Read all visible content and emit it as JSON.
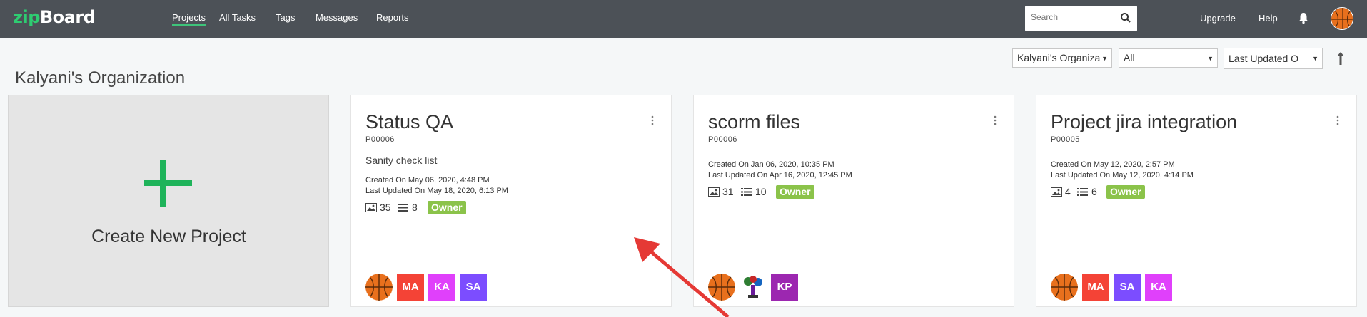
{
  "app": {
    "logo_zip": "zip",
    "logo_board": "Board",
    "nav": [
      "Projects",
      "All Tasks",
      "Tags",
      "Messages",
      "Reports"
    ],
    "search_placeholder": "Search",
    "upgrade": "Upgrade",
    "help": "Help"
  },
  "filters": {
    "organization": "Kalyani's Organiza",
    "status": "All",
    "sort": "Last Updated O"
  },
  "org_title": "Kalyani's Organization",
  "create_label": "Create New Project",
  "colors": {
    "accent_green": "#1fb35a",
    "owner_badge": "#8bc34a",
    "topbar": "#4c5157"
  },
  "projects": [
    {
      "title": "Status QA",
      "id": "P00006",
      "description": "Sanity check list",
      "created": "Created On May 06, 2020, 4:48 PM",
      "updated": "Last Updated On May 18, 2020, 6:13 PM",
      "images": "35",
      "lists": "8",
      "badge": "Owner",
      "members": [
        {
          "type": "ball"
        },
        {
          "initials": "MA",
          "color": "#f44336"
        },
        {
          "initials": "KA",
          "color": "#e040fb"
        },
        {
          "initials": "SA",
          "color": "#7c4dff"
        }
      ]
    },
    {
      "title": "scorm files",
      "id": "P00006",
      "description": "",
      "created": "Created On Jan 06, 2020, 10:35 PM",
      "updated": "Last Updated On Apr 16, 2020, 12:45 PM",
      "images": "31",
      "lists": "10",
      "badge": "Owner",
      "members": [
        {
          "type": "ball"
        },
        {
          "type": "figure"
        },
        {
          "initials": "KP",
          "color": "#9c27b0"
        }
      ]
    },
    {
      "title": "Project jira integration",
      "id": "P00005",
      "description": "",
      "created": "Created On May 12, 2020, 2:57 PM",
      "updated": "Last Updated On May 12, 2020, 4:14 PM",
      "images": "4",
      "lists": "6",
      "badge": "Owner",
      "members": [
        {
          "type": "ball"
        },
        {
          "initials": "MA",
          "color": "#f44336"
        },
        {
          "initials": "SA",
          "color": "#7c4dff"
        },
        {
          "initials": "KA",
          "color": "#e040fb"
        }
      ]
    }
  ]
}
